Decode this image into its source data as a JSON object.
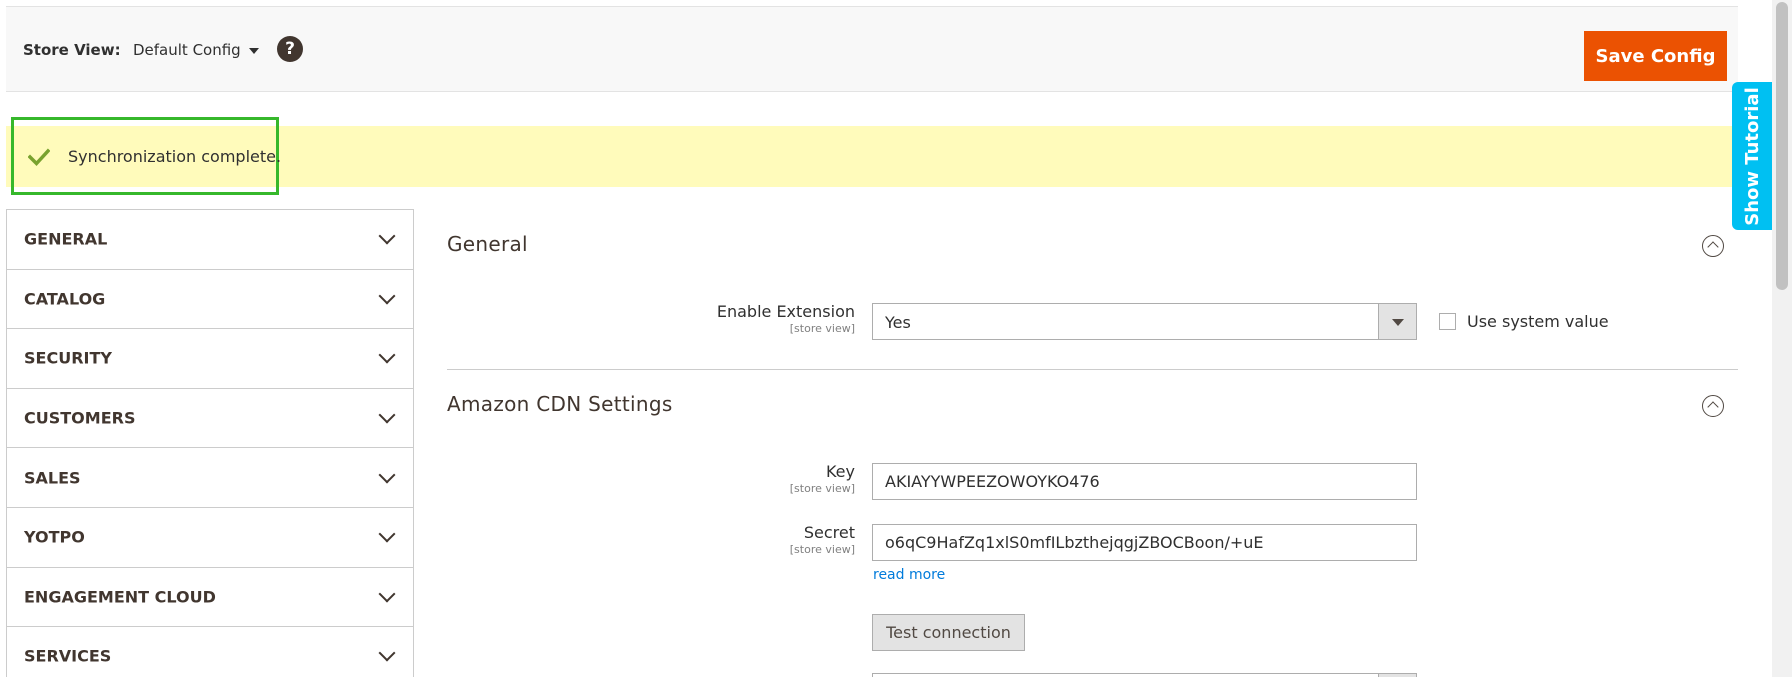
{
  "header": {
    "store_view_label": "Store View:",
    "store_view_value": "Default Config",
    "help_icon": "question-circle-icon",
    "save_button": "Save Config"
  },
  "message": {
    "text": "Synchronization complete.",
    "icon": "checkmark-icon",
    "highlight_color": "#36b82b",
    "background_color": "#fffbbb"
  },
  "tutorial_tab": {
    "label": "Show Tutorial",
    "color": "#00c0f2"
  },
  "sidebar": {
    "items": [
      {
        "label": "GENERAL"
      },
      {
        "label": "CATALOG"
      },
      {
        "label": "SECURITY"
      },
      {
        "label": "CUSTOMERS"
      },
      {
        "label": "SALES"
      },
      {
        "label": "YOTPO"
      },
      {
        "label": "ENGAGEMENT CLOUD"
      },
      {
        "label": "SERVICES"
      }
    ]
  },
  "sections": {
    "general": {
      "title": "General",
      "enable_extension": {
        "label": "Enable Extension",
        "scope": "[store view]",
        "value": "Yes",
        "use_system_value_label": "Use system value"
      }
    },
    "amazon_cdn": {
      "title": "Amazon CDN Settings",
      "key": {
        "label": "Key",
        "scope": "[store view]",
        "value": "AKIAYYWPEEZOWOYKO476"
      },
      "secret": {
        "label": "Secret",
        "scope": "[store view]",
        "value": "o6qC9HafZq1xlS0mfILbzthejqgjZBOCBoon/+uE",
        "read_more": "read more"
      },
      "test_connection_button": "Test connection"
    }
  },
  "colors": {
    "accent": "#eb5202",
    "link": "#007bdb"
  }
}
